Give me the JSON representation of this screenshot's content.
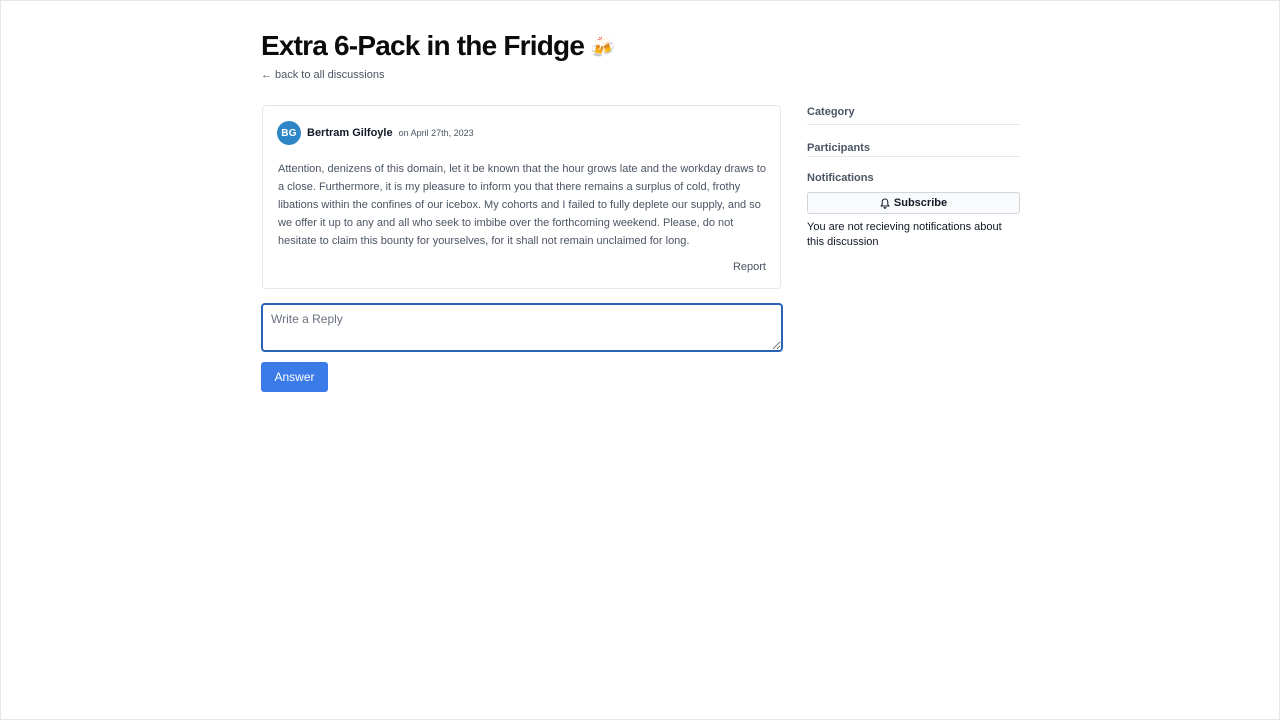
{
  "discussion": {
    "title": "Extra 6-Pack in the Fridge",
    "title_emoji": "🍻",
    "back_link": "back to all discussions",
    "back_arrow": "←"
  },
  "post": {
    "author_initials": "BG",
    "author_name": "Bertram Gilfoyle",
    "date": "on April 27th, 2023",
    "body": "Attention, denizens of this domain, let it be known that the hour grows late and the workday draws to a close. Furthermore, it is my pleasure to inform you that there remains a surplus of cold, frothy libations within the confines of our icebox. My cohorts and I failed to fully deplete our supply, and so we offer it up to any and all who seek to imbibe over the forthcoming weekend. Please, do not hesitate to claim this bounty for yourselves, for it shall not remain unclaimed for long.",
    "report_label": "Report",
    "avatar_color": "#2f86c7"
  },
  "reply": {
    "placeholder": "Write a Reply",
    "value": "",
    "submit_label": "Answer",
    "accent_color": "#3b7be8"
  },
  "sidebar": {
    "category_heading": "Category",
    "participants_heading": "Participants",
    "notifications_heading": "Notifications",
    "subscribe_label": "Subscribe",
    "subscribe_icon": "bell-icon",
    "notify_text": "You are not recieving notifications about this discussion"
  }
}
